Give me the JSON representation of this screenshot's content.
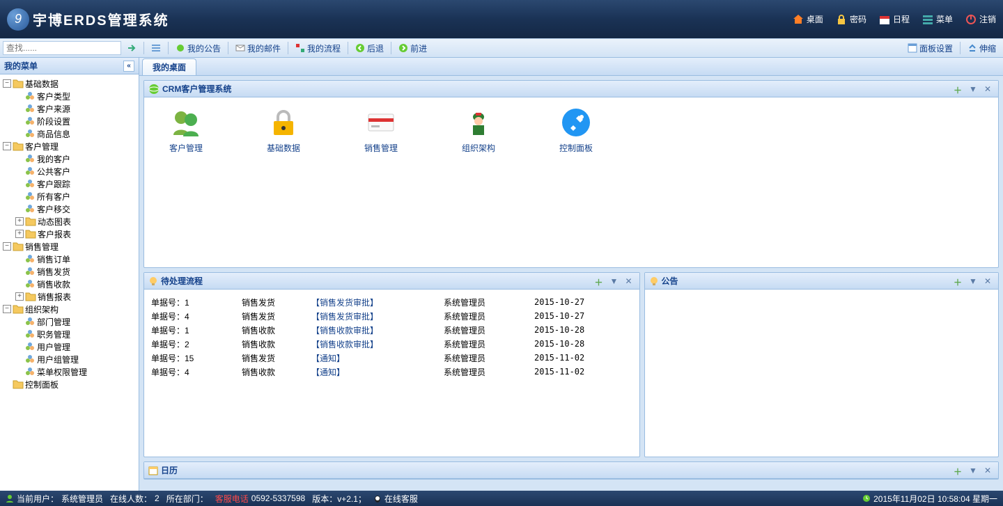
{
  "header": {
    "app_name": "宇博ERDS管理系统",
    "nav": [
      {
        "label": "桌面",
        "icon": "home"
      },
      {
        "label": "密码",
        "icon": "lock"
      },
      {
        "label": "日程",
        "icon": "calendar"
      },
      {
        "label": "菜单",
        "icon": "menu"
      },
      {
        "label": "注销",
        "icon": "power"
      }
    ]
  },
  "toolbar": {
    "search_placeholder": "查找......",
    "buttons": [
      {
        "label": "我的公告",
        "icon": "bullhorn"
      },
      {
        "label": "我的邮件",
        "icon": "mail"
      },
      {
        "label": "我的流程",
        "icon": "flow"
      },
      {
        "label": "后退",
        "icon": "back"
      },
      {
        "label": "前进",
        "icon": "forward"
      }
    ],
    "right": [
      {
        "label": "面板设置",
        "icon": "panel"
      },
      {
        "label": "伸缩",
        "icon": "expand"
      }
    ]
  },
  "sidebar": {
    "title": "我的菜单",
    "tree": [
      {
        "label": "基础数据",
        "level": 0,
        "type": "folder",
        "open": true
      },
      {
        "label": "客户类型",
        "level": 1,
        "type": "leaf"
      },
      {
        "label": "客户来源",
        "level": 1,
        "type": "leaf"
      },
      {
        "label": "阶段设置",
        "level": 1,
        "type": "leaf"
      },
      {
        "label": "商品信息",
        "level": 1,
        "type": "leaf"
      },
      {
        "label": "客户管理",
        "level": 0,
        "type": "folder",
        "open": true
      },
      {
        "label": "我的客户",
        "level": 1,
        "type": "leaf"
      },
      {
        "label": "公共客户",
        "level": 1,
        "type": "leaf"
      },
      {
        "label": "客户跟踪",
        "level": 1,
        "type": "leaf"
      },
      {
        "label": "所有客户",
        "level": 1,
        "type": "leaf"
      },
      {
        "label": "客户移交",
        "level": 1,
        "type": "leaf"
      },
      {
        "label": "动态图表",
        "level": 1,
        "type": "folder",
        "open": false
      },
      {
        "label": "客户报表",
        "level": 1,
        "type": "folder",
        "open": false
      },
      {
        "label": "销售管理",
        "level": 0,
        "type": "folder",
        "open": true
      },
      {
        "label": "销售订单",
        "level": 1,
        "type": "leaf"
      },
      {
        "label": "销售发货",
        "level": 1,
        "type": "leaf"
      },
      {
        "label": "销售收款",
        "level": 1,
        "type": "leaf"
      },
      {
        "label": "销售报表",
        "level": 1,
        "type": "folder",
        "open": false
      },
      {
        "label": "组织架构",
        "level": 0,
        "type": "folder",
        "open": true
      },
      {
        "label": "部门管理",
        "level": 1,
        "type": "leaf"
      },
      {
        "label": "职务管理",
        "level": 1,
        "type": "leaf"
      },
      {
        "label": "用户管理",
        "level": 1,
        "type": "leaf"
      },
      {
        "label": "用户组管理",
        "level": 1,
        "type": "leaf"
      },
      {
        "label": "菜单权限管理",
        "level": 1,
        "type": "leaf"
      },
      {
        "label": "控制面板",
        "level": 0,
        "type": "leaf-root"
      }
    ]
  },
  "tabs": {
    "active": "我的桌面"
  },
  "crm_panel": {
    "title": "CRM客户管理系统",
    "items": [
      {
        "label": "客户管理",
        "icon": "users"
      },
      {
        "label": "基础数据",
        "icon": "lock-big"
      },
      {
        "label": "销售管理",
        "icon": "card"
      },
      {
        "label": "组织架构",
        "icon": "soldier"
      },
      {
        "label": "控制面板",
        "icon": "tools"
      }
    ]
  },
  "pending_flow": {
    "title": "待处理流程",
    "rows": [
      {
        "c1": "单据号：1",
        "c2": "销售发货",
        "c3": "【销售发货审批】",
        "c4": "系统管理员",
        "c5": "2015-10-27"
      },
      {
        "c1": "单据号：4",
        "c2": "销售发货",
        "c3": "【销售发货审批】",
        "c4": "系统管理员",
        "c5": "2015-10-27"
      },
      {
        "c1": "单据号：1",
        "c2": "销售收款",
        "c3": "【销售收款审批】",
        "c4": "系统管理员",
        "c5": "2015-10-28"
      },
      {
        "c1": "单据号：2",
        "c2": "销售收款",
        "c3": "【销售收款审批】",
        "c4": "系统管理员",
        "c5": "2015-10-28"
      },
      {
        "c1": "单据号：15",
        "c2": "销售发货",
        "c3": "【通知】",
        "c4": "系统管理员",
        "c5": "2015-11-02"
      },
      {
        "c1": "单据号：4",
        "c2": "销售收款",
        "c3": "【通知】",
        "c4": "系统管理员",
        "c5": "2015-11-02"
      }
    ]
  },
  "notice_panel": {
    "title": "公告"
  },
  "calendar_panel": {
    "title": "日历"
  },
  "footer": {
    "current_user_label": "当前用户：",
    "current_user": "系统管理员",
    "online_label": "在线人数：",
    "online_count": "2",
    "dept_label": "所在部门：",
    "hotline_label": "客服电话",
    "hotline": "0592-5337598",
    "version_label": "版本：v+2.1；",
    "online_cs": "在线客服",
    "datetime": "2015年11月02日 10:58:04 星期一"
  }
}
